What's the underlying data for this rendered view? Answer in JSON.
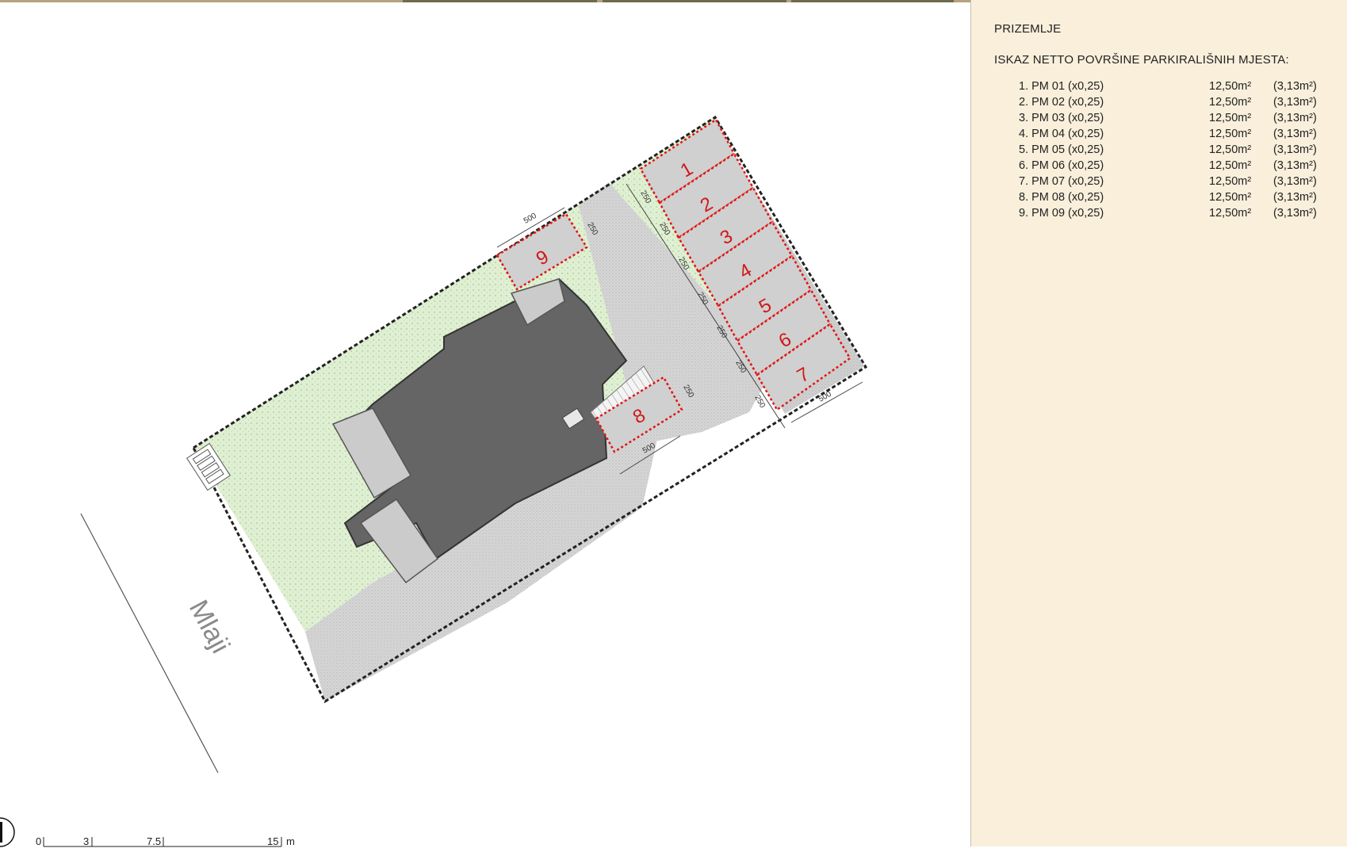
{
  "street_label": "Mlaji",
  "colors": {
    "lot_green": "#dff0d2",
    "road_gray": "#d6d6d6",
    "building": "#656565",
    "terrace": "#cbcbcb",
    "parking_outline": "#e01515",
    "panel_bg": "#f9efdb"
  },
  "parking_numbers": [
    "1",
    "2",
    "3",
    "4",
    "5",
    "6",
    "7",
    "8",
    "9"
  ],
  "dimensions": {
    "width_500": "500",
    "spacing_250": "250"
  },
  "scale_bar": {
    "ticks": [
      "0",
      "3",
      "7.5",
      "15"
    ],
    "unit": "m"
  },
  "panel": {
    "title": "PRIZEMLJE",
    "subtitle": "ISKAZ NETTO POVRŠINE PARKIRALIŠNIH MJESTA:",
    "rows": [
      {
        "label": "1. PM 01 (x0,25)",
        "area": "12,50m²",
        "net": "(3,13m²)"
      },
      {
        "label": "2. PM 02 (x0,25)",
        "area": "12,50m²",
        "net": "(3,13m²)"
      },
      {
        "label": "3. PM 03 (x0,25)",
        "area": "12,50m²",
        "net": "(3,13m²)"
      },
      {
        "label": "4. PM 04 (x0,25)",
        "area": "12,50m²",
        "net": "(3,13m²)"
      },
      {
        "label": "5. PM 05 (x0,25)",
        "area": "12,50m²",
        "net": "(3,13m²)"
      },
      {
        "label": "6. PM 06 (x0,25)",
        "area": "12,50m²",
        "net": "(3,13m²)"
      },
      {
        "label": "7. PM 07 (x0,25)",
        "area": "12,50m²",
        "net": "(3,13m²)"
      },
      {
        "label": "8. PM 08 (x0,25)",
        "area": "12,50m²",
        "net": "(3,13m²)"
      },
      {
        "label": "9. PM 09 (x0,25)",
        "area": "12,50m²",
        "net": "(3,13m²)"
      }
    ]
  }
}
